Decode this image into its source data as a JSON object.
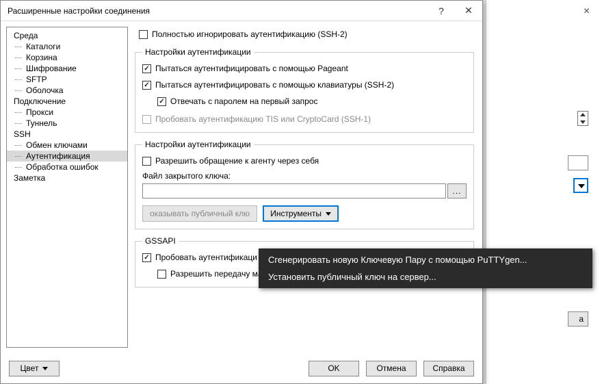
{
  "dialog": {
    "title": "Расширенные настройки соединения",
    "help_symbol": "?",
    "close_symbol": "✕"
  },
  "tree": {
    "items": [
      {
        "label": "Среда",
        "level": 0
      },
      {
        "label": "Каталоги",
        "level": 1
      },
      {
        "label": "Корзина",
        "level": 1
      },
      {
        "label": "Шифрование",
        "level": 1
      },
      {
        "label": "SFTP",
        "level": 1
      },
      {
        "label": "Оболочка",
        "level": 1
      },
      {
        "label": "Подключение",
        "level": 0
      },
      {
        "label": "Прокси",
        "level": 1
      },
      {
        "label": "Туннель",
        "level": 1
      },
      {
        "label": "SSH",
        "level": 0
      },
      {
        "label": "Обмен ключами",
        "level": 1
      },
      {
        "label": "Аутентификация",
        "level": 1,
        "selected": true
      },
      {
        "label": "Обработка ошибок",
        "level": 1
      },
      {
        "label": "Заметка",
        "level": 0
      }
    ]
  },
  "content": {
    "bypass_auth": "Полностью игнорировать аутентификацию (SSH-2)",
    "group1_title": "Настройки аутентификации",
    "pageant": "Пытаться аутентифицировать с помощью Pageant",
    "keyboard": "Пытаться аутентифицировать с помощью клавиатуры (SSH-2)",
    "respond_pw": "Отвечать с паролем на первый запрос",
    "tis": "Пробовать аутентификацию TIS или CryptoCard (SSH-1)",
    "group2_title": "Настройки аутентификации",
    "agent_fwd": "Разрешить обращение к агенту через себя",
    "keyfile_label": "Файл закрытого ключа:",
    "keyfile_value": "",
    "browse": "...",
    "show_pubkey": "оказывать публичный клю",
    "tools": "Инструменты",
    "group3_title": "GSSAPI",
    "gssapi_try": "Пробовать аутентификаци",
    "gssapi_deleg": "Разрешить передачу мандата GSSAPI"
  },
  "popup": {
    "item1": "Сгенерировать новую Ключевую Пару с помощью PuTTYgen...",
    "item2": "Установить публичный ключ на сервер..."
  },
  "bottom": {
    "color": "Цвет",
    "ok": "OK",
    "cancel": "Отмена",
    "help": "Справка"
  },
  "bg": {
    "btn": "а"
  }
}
